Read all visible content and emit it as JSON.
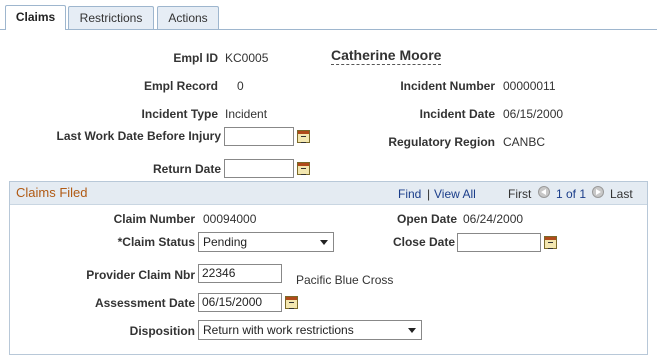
{
  "tabs": [
    {
      "label": "Claims",
      "active": true
    },
    {
      "label": "Restrictions",
      "active": false
    },
    {
      "label": "Actions",
      "active": false
    }
  ],
  "header": {
    "empl_id_label": "Empl ID",
    "empl_id": "KC0005",
    "employee_name": "Catherine Moore",
    "empl_record_label": "Empl Record",
    "empl_record": "0",
    "incident_number_label": "Incident Number",
    "incident_number": "00000011",
    "incident_type_label": "Incident Type",
    "incident_type": "Incident",
    "incident_date_label": "Incident Date",
    "incident_date": "06/15/2000",
    "last_work_date_label": "Last Work Date Before Injury",
    "last_work_date": "",
    "regulatory_region_label": "Regulatory Region",
    "regulatory_region": "CANBC",
    "return_date_label": "Return Date",
    "return_date": ""
  },
  "claims_filed": {
    "title": "Claims Filed",
    "find_label": "Find",
    "separator": "|",
    "view_all_label": "View All",
    "first_label": "First",
    "pager": "1 of 1",
    "last_label": "Last",
    "claim_number_label": "Claim Number",
    "claim_number": "00094000",
    "open_date_label": "Open Date",
    "open_date": "06/24/2000",
    "claim_status_label": "*Claim Status",
    "claim_status": "Pending",
    "close_date_label": "Close Date",
    "close_date": "",
    "provider_claim_nbr_label": "Provider Claim Nbr",
    "provider_claim_nbr": "22346",
    "provider_name": "Pacific Blue Cross",
    "assessment_date_label": "Assessment Date",
    "assessment_date": "06/15/2000",
    "disposition_label": "Disposition",
    "disposition": "Return with work restrictions"
  }
}
